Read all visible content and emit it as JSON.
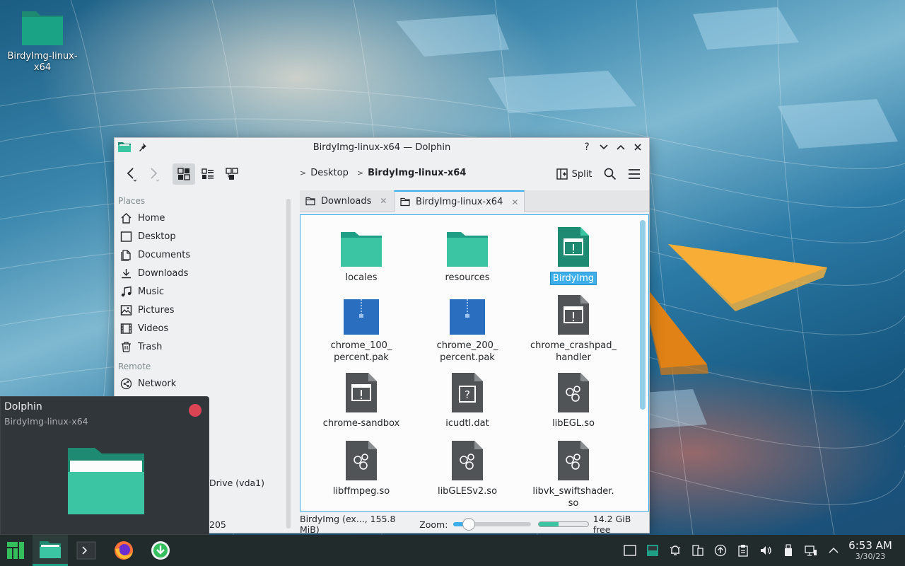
{
  "desktop": {
    "icon_label": "BirdyImg-linux-x64"
  },
  "window": {
    "title": "BirdyImg-linux-x64 — Dolphin",
    "help_glyph": "?"
  },
  "toolbar": {
    "breadcrumb": [
      "Desktop",
      "BirdyImg-linux-x64"
    ],
    "split_label": "Split"
  },
  "places": {
    "heading_places": "Places",
    "items": [
      "Home",
      "Desktop",
      "Documents",
      "Downloads",
      "Music",
      "Pictures",
      "Videos",
      "Trash"
    ],
    "heading_remote": "Remote",
    "remote_items": [
      "Network"
    ]
  },
  "tabs": [
    {
      "label": "Downloads",
      "active": false
    },
    {
      "label": "BirdyImg-linux-x64",
      "active": true
    }
  ],
  "files": [
    {
      "name": "locales",
      "type": "folder"
    },
    {
      "name": "resources",
      "type": "folder"
    },
    {
      "name": "BirdyImg",
      "type": "executable-green",
      "selected": true
    },
    {
      "name": "chrome_100_\npercent.pak",
      "type": "archive"
    },
    {
      "name": "chrome_200_\npercent.pak",
      "type": "archive"
    },
    {
      "name": "chrome_crashpad_\nhandler",
      "type": "executable"
    },
    {
      "name": "chrome-sandbox",
      "type": "executable"
    },
    {
      "name": "icudtl.dat",
      "type": "unknown"
    },
    {
      "name": "libEGL.so",
      "type": "library"
    },
    {
      "name": "libffmpeg.so",
      "type": "library"
    },
    {
      "name": "libGLESv2.so",
      "type": "library"
    },
    {
      "name": "libvk_swiftshader.\nso",
      "type": "library"
    }
  ],
  "status": {
    "selection": "BirdyImg (ex..., 155.8 MiB)",
    "zoom_label": "Zoom:",
    "zoom_level": 0.2,
    "free_fraction": 0.4,
    "free_space": "14.2 GiB free"
  },
  "tooltip": {
    "app": "Dolphin",
    "window": "BirdyImg-linux-x64",
    "peek_drive": "Drive (vda1)",
    "peek_num": "205"
  },
  "clock": {
    "time": "6:53 AM",
    "date": "3/30/23"
  },
  "colors": {
    "accent": "#3daee9",
    "folder": "#3cc5a3",
    "taskbar": "#222b2c"
  }
}
